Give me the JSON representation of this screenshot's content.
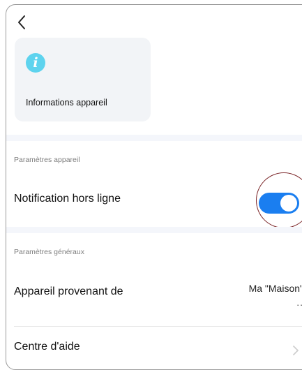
{
  "header": {
    "back_icon": "chevron-left-icon"
  },
  "info_card": {
    "icon": "info-icon",
    "icon_glyph": "i",
    "icon_color": "#5ed3ee",
    "label": "Informations appareil"
  },
  "device_settings": {
    "section_title": "Paramètres appareil",
    "offline_notification": {
      "label": "Notification hors ligne",
      "toggle_state": true,
      "toggle_color": "#1a7ef0"
    }
  },
  "general_settings": {
    "section_title": "Paramètres généraux",
    "device_source": {
      "label": "Appareil provenant de",
      "value": "Ma \"Maison\"",
      "value_more": ".."
    },
    "help_center": {
      "label": "Centre d'aide",
      "icon": "chevron-right-icon"
    }
  },
  "annotation": {
    "highlight_color": "#7a2427"
  }
}
